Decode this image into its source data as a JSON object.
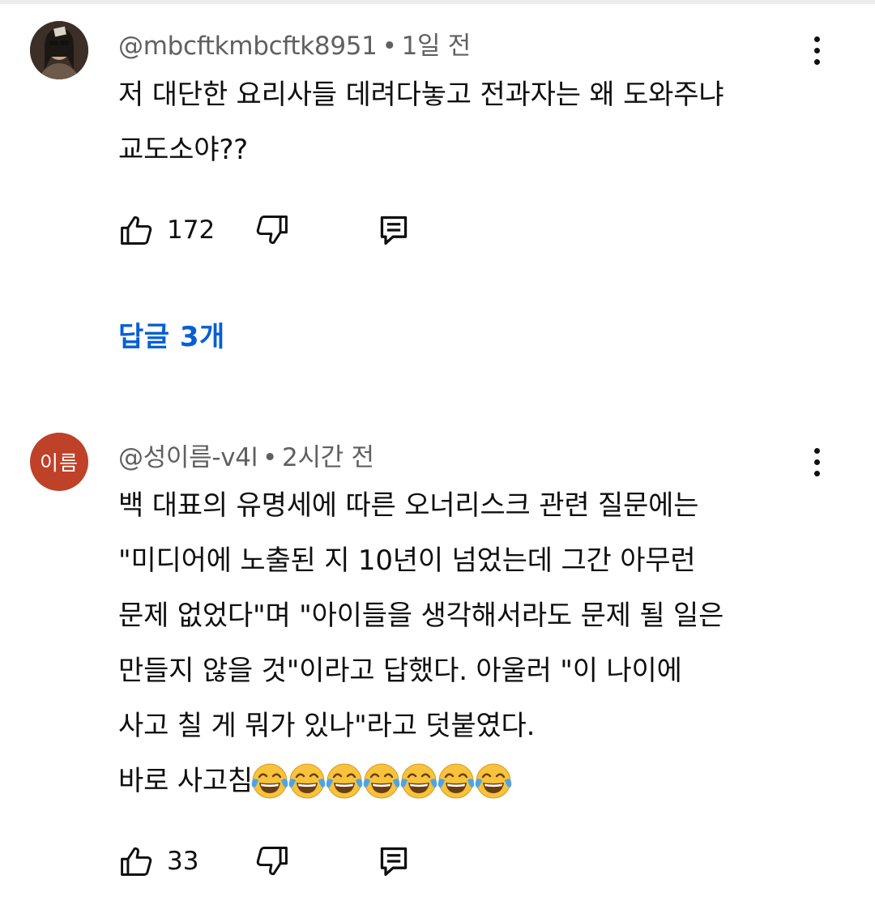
{
  "comments": [
    {
      "author": "@mbcftkmbcftk8951",
      "time": "1일 전",
      "avatar": {
        "type": "photo",
        "icon": "user-photo-avatar"
      },
      "lines": [
        "저 대단한 요리사들 데려다놓고 전과자는 왜 도와주냐",
        "교도소야??"
      ],
      "likes": "172",
      "replies_label": "답글 3개"
    },
    {
      "author": "@성이름-v4l",
      "time": "2시간 전",
      "avatar": {
        "type": "letter",
        "text": "이름",
        "color": "#bf4128"
      },
      "lines": [
        "백 대표의 유명세에 따른 오너리스크 관련 질문에는",
        "\"미디어에 노출된 지 10년이 넘었는데 그간 아무런",
        "문제 없었다\"며 \"아이들을 생각해서라도 문제 될 일은",
        "만들지 않을 것\"이라고 답했다. 아울러 \"이 나이에",
        "사고 칠 게 뭐가 있나\"라고 덧붙였다.",
        "바로 사고침"
      ],
      "emoji": {
        "name": "face-with-tears-of-joy-icon",
        "count": 7
      },
      "likes": "33"
    }
  ],
  "separator": "•",
  "colors": {
    "text": "#0f0f0f",
    "meta": "#606060",
    "link": "#065fd4",
    "emoji_face": "#f7c23c"
  }
}
